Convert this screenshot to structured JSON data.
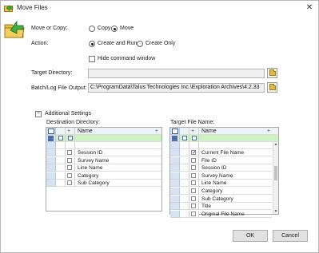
{
  "window": {
    "title": "Move Files",
    "close_glyph": "✕"
  },
  "form": {
    "move_or_copy_label": "Move or Copy:",
    "copy_option": "Copy",
    "move_option": "Move",
    "move_selected": true,
    "action_label": "Action:",
    "create_and_run_option": "Create and Run",
    "create_only_option": "Create Only",
    "create_and_run_selected": true,
    "hide_command_window_label": "Hide command window",
    "hide_command_window_checked": false,
    "target_directory_label": "Target Directory:",
    "target_directory_value": "",
    "batch_log_label": "Batch/Log File Output:",
    "batch_log_value": "C:\\ProgramData\\Talus Technologies Inc.\\Exploration Archives\\4.2.33"
  },
  "additional_settings": {
    "label": "Additional Settings",
    "expander_glyph": "−",
    "destination": {
      "label": "Destination Directory:",
      "plus_glyph": "+",
      "column_header": "Name",
      "rows": [
        {
          "name": "Session ID",
          "checked": false
        },
        {
          "name": "Survey Name",
          "checked": false
        },
        {
          "name": "Line Name",
          "checked": false
        },
        {
          "name": "Category",
          "checked": false
        },
        {
          "name": "Sub Category",
          "checked": false
        }
      ]
    },
    "target_file_name": {
      "label": "Target File Name:",
      "plus_glyph": "+",
      "column_header": "Name",
      "rows": [
        {
          "name": "Current File Name",
          "checked": true
        },
        {
          "name": "File ID",
          "checked": false
        },
        {
          "name": "Session ID",
          "checked": false
        },
        {
          "name": "Survey Name",
          "checked": false
        },
        {
          "name": "Line Name",
          "checked": false
        },
        {
          "name": "Category",
          "checked": false
        },
        {
          "name": "Sub Category",
          "checked": false
        },
        {
          "name": "Title",
          "checked": false
        },
        {
          "name": "Original File Name",
          "checked": false
        }
      ]
    }
  },
  "buttons": {
    "ok": "OK",
    "cancel": "Cancel"
  },
  "icons": {
    "title": "move-files-icon",
    "big": "move-files-icon",
    "browse": "folder-icon",
    "grid_header": "column-chooser-icon",
    "filter": "filter-icon",
    "check": "✓"
  },
  "colors": {
    "filter_row": "#cdf3c3",
    "header_row": "#eef1f6",
    "selector_column": "#d7e2f3"
  }
}
